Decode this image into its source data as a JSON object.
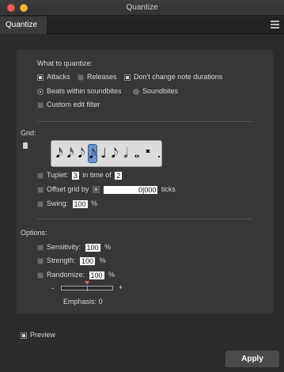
{
  "window": {
    "title": "Quantize"
  },
  "tabs": {
    "active": "Quantize"
  },
  "what": {
    "heading": "What to quantize:",
    "attacks": "Attacks",
    "releases": "Releases",
    "dont_change": "Don't change note durations",
    "beats": "Beats within soundbites",
    "soundbites": "Soundbites",
    "custom": "Custom edit filter"
  },
  "grid": {
    "heading": "Grid:",
    "notes": [
      "𝅘𝅥𝅯",
      "𝅘𝅥𝅯",
      "𝅘𝅥𝅮",
      "𝅘𝅥𝅮",
      "♩",
      "𝅘𝅥𝅮",
      "𝅗𝅥",
      "𝅝",
      "𝄺",
      "."
    ],
    "selected_note_index": 3,
    "tuplet_label": "Tuplet:",
    "tuplet_value": "3",
    "in_time_of_label": "in time of",
    "in_time_of_value": "2",
    "offset_label": "Offset grid by",
    "offset_sign": "+",
    "offset_value": "0|000",
    "ticks_label": "ticks",
    "swing_label": "Swing:",
    "swing_value": "100",
    "swing_unit": "%"
  },
  "options": {
    "heading": "Options:",
    "sensitivity_label": "Sensitivity:",
    "sensitivity_value": "100",
    "strength_label": "Strength:",
    "strength_value": "100",
    "randomize_label": "Randomize:",
    "randomize_value": "100",
    "unit": "%",
    "minus": "-",
    "plus": "+",
    "emphasis_label": "Emphasis: 0"
  },
  "footer": {
    "preview_label": "Preview",
    "apply_label": "Apply"
  }
}
